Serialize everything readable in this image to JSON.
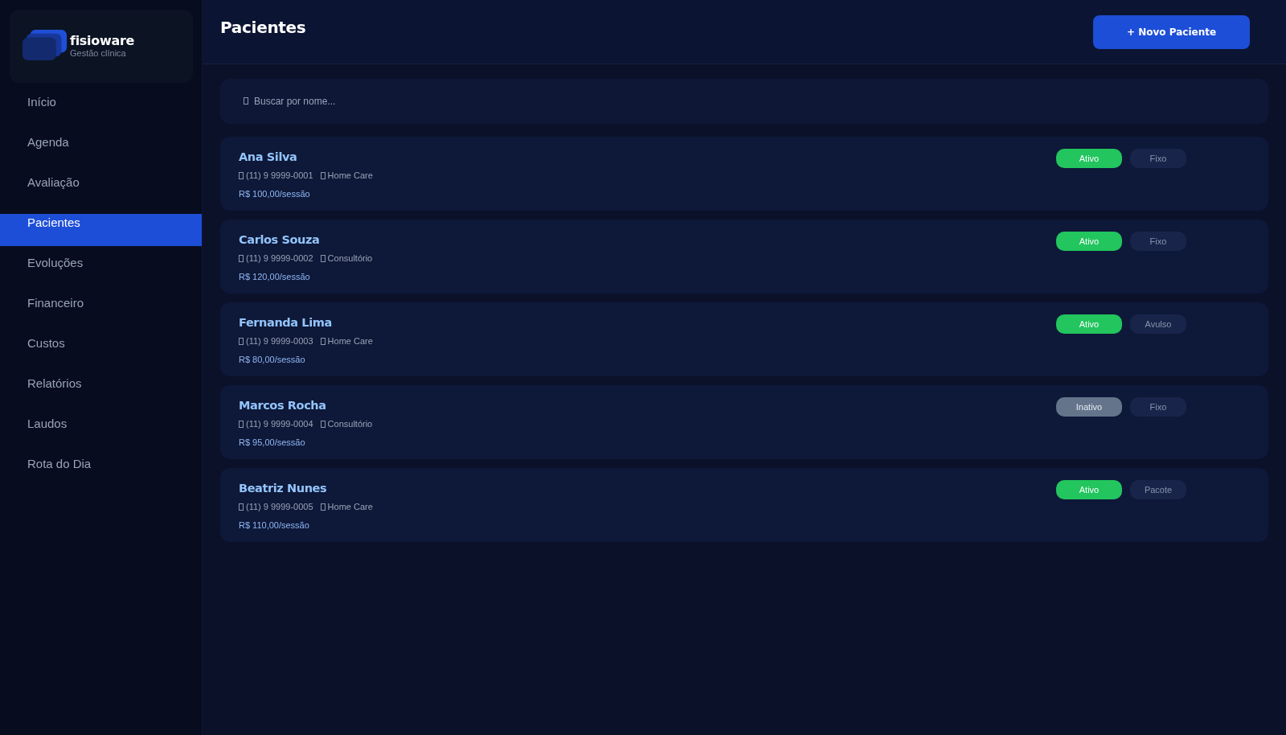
{
  "app": {
    "name": "fisioware",
    "tagline": "Gestão clínica"
  },
  "sidebar": {
    "items": [
      {
        "label": "Início",
        "selected": false
      },
      {
        "label": "Agenda",
        "selected": false
      },
      {
        "label": "Avaliação",
        "selected": false
      },
      {
        "label": "Pacientes",
        "selected": true
      },
      {
        "label": "Evoluções",
        "selected": false
      },
      {
        "label": "Financeiro",
        "selected": false
      },
      {
        "label": "Custos",
        "selected": false
      },
      {
        "label": "Relatórios",
        "selected": false
      },
      {
        "label": "Laudos",
        "selected": false
      },
      {
        "label": "Rota do Dia",
        "selected": false
      }
    ]
  },
  "header": {
    "title": "Pacientes",
    "button": "+ Novo Paciente"
  },
  "search": {
    "placeholder": "Buscar por nome..."
  },
  "patients": [
    {
      "name": "Ana Silva",
      "phone": "(11) 9 9999-0001",
      "location": "Home Care",
      "price": "R$ 100,00/sessão",
      "status": "Ativo",
      "active": true,
      "plan": "Fixo"
    },
    {
      "name": "Carlos Souza",
      "phone": "(11) 9 9999-0002",
      "location": "Consultório",
      "price": "R$ 120,00/sessão",
      "status": "Ativo",
      "active": true,
      "plan": "Fixo"
    },
    {
      "name": "Fernanda Lima",
      "phone": "(11) 9 9999-0003",
      "location": "Home Care",
      "price": "R$ 80,00/sessão",
      "status": "Ativo",
      "active": true,
      "plan": "Avulso"
    },
    {
      "name": "Marcos Rocha",
      "phone": "(11) 9 9999-0004",
      "location": "Consultório",
      "price": "R$ 95,00/sessão",
      "status": "Inativo",
      "active": false,
      "plan": "Fixo"
    },
    {
      "name": "Beatriz Nunes",
      "phone": "(11) 9 9999-0005",
      "location": "Home Care",
      "price": "R$ 110,00/sessão",
      "status": "Ativo",
      "active": true,
      "plan": "Pacote"
    }
  ]
}
